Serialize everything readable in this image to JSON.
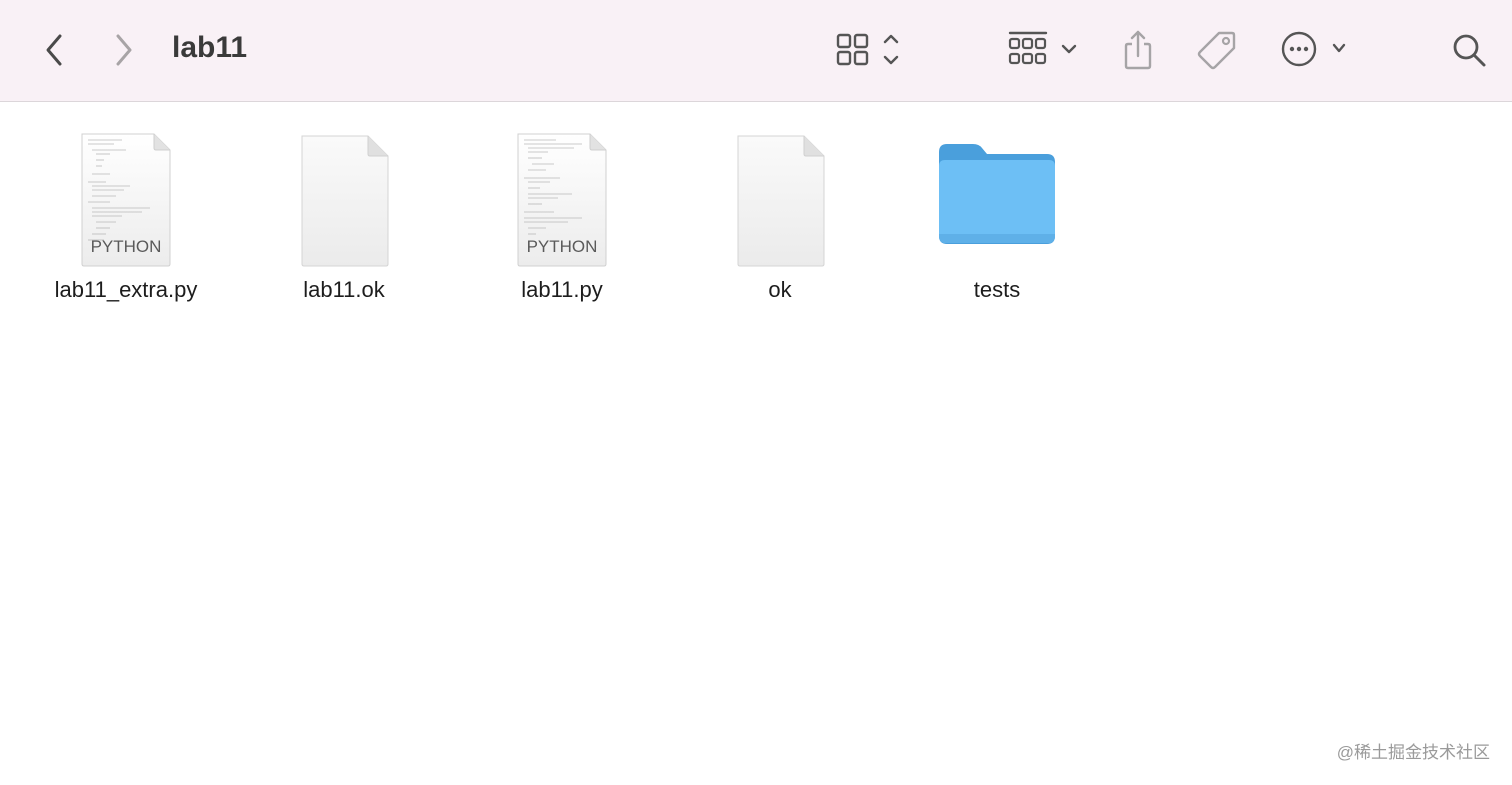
{
  "window": {
    "title": "lab11"
  },
  "toolbar": {
    "back_icon": "chevron-left-icon",
    "forward_icon": "chevron-right-icon",
    "view_icon": "icon-grid-view-icon",
    "group_icon": "group-by-icon",
    "share_icon": "share-icon",
    "tag_icon": "tag-icon",
    "more_icon": "ellipsis-circle-icon",
    "search_icon": "search-icon"
  },
  "files": [
    {
      "name": "lab11_extra.py",
      "kind": "python",
      "badge": "PYTHON"
    },
    {
      "name": "lab11.ok",
      "kind": "document",
      "badge": ""
    },
    {
      "name": "lab11.py",
      "kind": "python",
      "badge": "PYTHON"
    },
    {
      "name": "ok",
      "kind": "document",
      "badge": ""
    },
    {
      "name": "tests",
      "kind": "folder",
      "badge": ""
    }
  ],
  "colors": {
    "toolbar_bg": "#f9f1f6",
    "folder_blue": "#6dbff5",
    "folder_tab": "#4a9fdc"
  },
  "watermark": "@稀土掘金技术社区"
}
